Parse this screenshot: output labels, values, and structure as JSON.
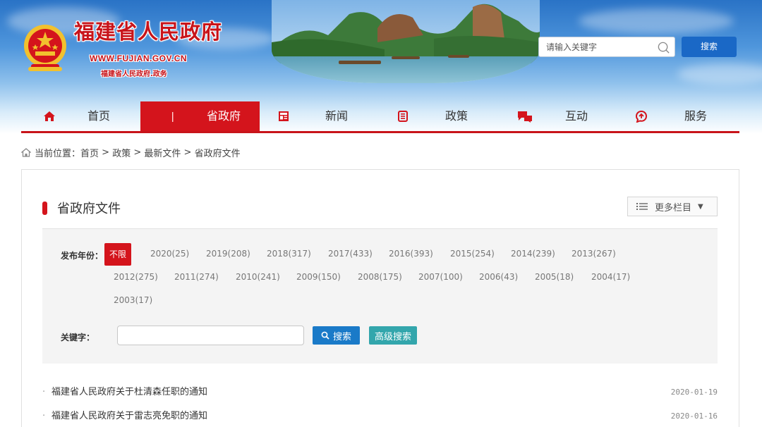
{
  "header": {
    "site_title": "福建省人民政府",
    "site_url": "WWW.FUJIAN.GOV.CN",
    "site_subtitle": "福建省人民政府.政务",
    "search_placeholder": "请输入关键字",
    "search_button": "搜索"
  },
  "nav": {
    "items": [
      {
        "label": "首页",
        "icon": "home-icon"
      },
      {
        "label": "省政府",
        "icon": "government-icon"
      },
      {
        "label": "新闻",
        "icon": "news-icon"
      },
      {
        "label": "政策",
        "icon": "policy-icon"
      },
      {
        "label": "互动",
        "icon": "chat-icon"
      },
      {
        "label": "服务",
        "icon": "service-icon"
      }
    ],
    "active": "省政府",
    "accent_color": "#d4141c"
  },
  "breadcrumb": {
    "prefix": "当前位置：",
    "path": [
      "首页",
      "政策",
      "最新文件",
      "省政府文件"
    ],
    "separator": " > "
  },
  "section": {
    "title": "省政府文件",
    "more_label": "更多栏目"
  },
  "filter": {
    "year_label": "发布年份：",
    "years": [
      "不限",
      "2020(25)",
      "2019(208)",
      "2018(317)",
      "2017(433)",
      "2016(393)",
      "2015(254)",
      "2014(239)",
      "2013(267)",
      "2012(275)",
      "2011(274)",
      "2010(241)",
      "2009(150)",
      "2008(175)",
      "2007(100)",
      "2006(43)",
      "2005(18)",
      "2004(17)",
      "2003(17)"
    ],
    "selected_year": "不限",
    "keyword_label": "关键字：",
    "keyword_value": "",
    "search_button": "搜索",
    "advanced_button": "高级搜索"
  },
  "documents": [
    {
      "title": "福建省人民政府关于杜清森任职的通知",
      "date": "2020-01-19"
    },
    {
      "title": "福建省人民政府关于雷志亮免职的通知",
      "date": "2020-01-16"
    }
  ]
}
